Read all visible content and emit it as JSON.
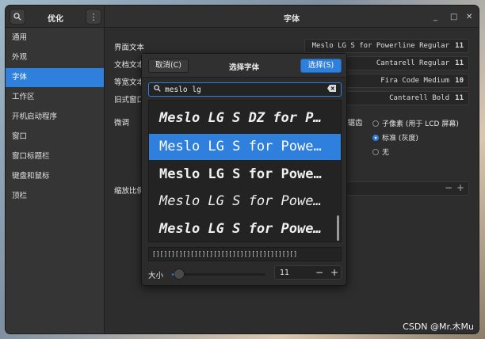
{
  "sidebar_header": {
    "title": "优化"
  },
  "sidebar": {
    "items": [
      {
        "label": "通用"
      },
      {
        "label": "外观"
      },
      {
        "label": "字体"
      },
      {
        "label": "工作区"
      },
      {
        "label": "开机启动程序"
      },
      {
        "label": "窗口"
      },
      {
        "label": "窗口标题栏"
      },
      {
        "label": "键盘和鼠标"
      },
      {
        "label": "顶栏"
      }
    ],
    "active_index": 2
  },
  "main": {
    "title": "字体",
    "rows": [
      {
        "label": "界面文本",
        "font": "Meslo LG S for Powerline Regular",
        "size": "11"
      },
      {
        "label": "文档文本",
        "font": "Cantarell Regular",
        "size": "11"
      },
      {
        "label": "等宽文本",
        "font": "Fira Code Medium",
        "size": "10"
      },
      {
        "label": "旧式窗口",
        "font": "Cantarell Bold",
        "size": "11"
      }
    ],
    "hinting_label": "微调",
    "antialias_label": "抗锯齿",
    "antialias_options": [
      {
        "label": "子像素 (用于 LCD 屏幕)",
        "selected": false
      },
      {
        "label": "标准 (灰度)",
        "selected": true
      },
      {
        "label": "无",
        "selected": false
      }
    ],
    "scale_label": "缩放比例"
  },
  "dialog": {
    "title": "选择字体",
    "cancel_label": "取消(C)",
    "select_label": "选择(S)",
    "search_value": "meslo lg",
    "fonts": [
      {
        "name": "Meslo LG S DZ for Powerline Bold Italic",
        "style": "bi",
        "selected": false
      },
      {
        "name": "Meslo LG S for Powerline Regular",
        "style": "r",
        "selected": true
      },
      {
        "name": "Meslo LG S for Powerline Bold",
        "style": "b",
        "selected": false
      },
      {
        "name": "Meslo LG S for Powerline Italic",
        "style": "i",
        "selected": false
      },
      {
        "name": "Meslo LG S for Powerline Bold Italic",
        "style": "bi",
        "selected": false
      }
    ],
    "preview_text": "[][][][][][][][][][][][][][][][][][][]",
    "size_label": "大小",
    "size_value": "11",
    "size_slider_fraction": 0.08
  },
  "watermark": "CSDN @Mr.木Mu",
  "colors": {
    "accent": "#2f7fdc",
    "window_bg": "#2d2d2d",
    "sidebar_bg": "#353535"
  }
}
